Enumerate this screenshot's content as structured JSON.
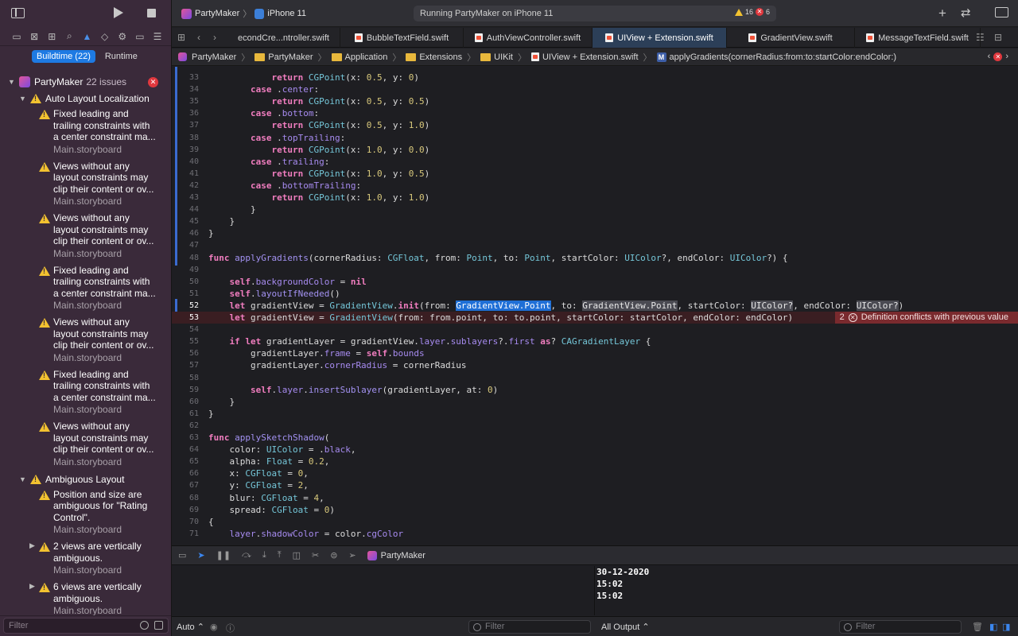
{
  "toolbar": {
    "scheme": "PartyMaker",
    "device": "iPhone 11",
    "status": "Running PartyMaker on iPhone 11",
    "warning_count": "16",
    "error_count": "6"
  },
  "navigator": {
    "segments": {
      "buildtime": "Buildtime (22)",
      "runtime": "Runtime"
    },
    "project": {
      "name": "PartyMaker",
      "issues": "22 issues"
    },
    "groups": [
      {
        "title": "Auto Layout Localization",
        "items": [
          {
            "lines": [
              "Fixed leading and",
              "trailing constraints with",
              "a center constraint ma..."
            ],
            "file": "Main.storyboard"
          },
          {
            "lines": [
              "Views without any",
              "layout constraints may",
              "clip their content or ov..."
            ],
            "file": "Main.storyboard"
          },
          {
            "lines": [
              "Views without any",
              "layout constraints may",
              "clip their content or ov..."
            ],
            "file": "Main.storyboard"
          },
          {
            "lines": [
              "Fixed leading and",
              "trailing constraints with",
              "a center constraint ma..."
            ],
            "file": "Main.storyboard"
          },
          {
            "lines": [
              "Views without any",
              "layout constraints may",
              "clip their content or ov..."
            ],
            "file": "Main.storyboard"
          },
          {
            "lines": [
              "Fixed leading and",
              "trailing constraints with",
              "a center constraint ma..."
            ],
            "file": "Main.storyboard"
          },
          {
            "lines": [
              "Views without any",
              "layout constraints may",
              "clip their content or ov..."
            ],
            "file": "Main.storyboard"
          }
        ]
      },
      {
        "title": "Ambiguous Layout",
        "items": [
          {
            "lines": [
              "Position and size are",
              "ambiguous for \"Rating",
              "Control\"."
            ],
            "file": "Main.storyboard"
          },
          {
            "lines": [
              "2 views are vertically",
              "ambiguous."
            ],
            "file": "Main.storyboard"
          },
          {
            "lines": [
              "6 views are vertically",
              "ambiguous."
            ],
            "file": "Main.storyboard"
          }
        ]
      }
    ],
    "filter_placeholder": "Filter"
  },
  "tabs": [
    "econdCre...ntroller.swift",
    "BubbleTextField.swift",
    "AuthViewController.swift",
    "UIView + Extension.swift",
    "GradientView.swift",
    "MessageTextField.swift"
  ],
  "active_tab": "UIView + Extension.swift",
  "jumpbar": [
    "PartyMaker",
    "PartyMaker",
    "Application",
    "Extensions",
    "UIKit",
    "UIView + Extension.swift",
    "applyGradients(cornerRadius:from:to:startColor:endColor:)"
  ],
  "jumpbar_method_letter": "M",
  "editor": {
    "lines": [
      {
        "n": "33",
        "t": ""
      },
      {
        "n": "34",
        "t": ""
      },
      {
        "n": "35",
        "t": ""
      },
      {
        "n": "36",
        "t": ""
      },
      {
        "n": "37",
        "t": ""
      },
      {
        "n": "38",
        "t": ""
      },
      {
        "n": "39",
        "t": ""
      },
      {
        "n": "40",
        "t": ""
      },
      {
        "n": "41",
        "t": ""
      },
      {
        "n": "42",
        "t": ""
      },
      {
        "n": "43",
        "t": ""
      },
      {
        "n": "44",
        "t": ""
      },
      {
        "n": "45",
        "t": ""
      },
      {
        "n": "46",
        "t": ""
      },
      {
        "n": "47",
        "t": ""
      },
      {
        "n": "48",
        "t": ""
      },
      {
        "n": "49",
        "t": ""
      },
      {
        "n": "50",
        "t": ""
      },
      {
        "n": "51",
        "t": ""
      },
      {
        "n": "52",
        "t": ""
      },
      {
        "n": "53",
        "t": ""
      },
      {
        "n": "54",
        "t": ""
      },
      {
        "n": "55",
        "t": ""
      },
      {
        "n": "56",
        "t": ""
      },
      {
        "n": "57",
        "t": ""
      },
      {
        "n": "58",
        "t": ""
      },
      {
        "n": "59",
        "t": ""
      },
      {
        "n": "60",
        "t": ""
      },
      {
        "n": "61",
        "t": ""
      },
      {
        "n": "62",
        "t": ""
      },
      {
        "n": "63",
        "t": ""
      },
      {
        "n": "64",
        "t": ""
      },
      {
        "n": "65",
        "t": ""
      },
      {
        "n": "66",
        "t": ""
      },
      {
        "n": "67",
        "t": ""
      },
      {
        "n": "68",
        "t": ""
      },
      {
        "n": "69",
        "t": ""
      },
      {
        "n": "70",
        "t": ""
      },
      {
        "n": "71",
        "t": ""
      }
    ],
    "error": {
      "count": "2",
      "message": "Definition conflicts with previous value"
    }
  },
  "debug": {
    "process": "PartyMaker",
    "console_lines": [
      "30-12-2020",
      "15:02",
      "15:02"
    ],
    "auto_label": "Auto",
    "output_label": "All Output",
    "filter_placeholder": "Filter"
  }
}
